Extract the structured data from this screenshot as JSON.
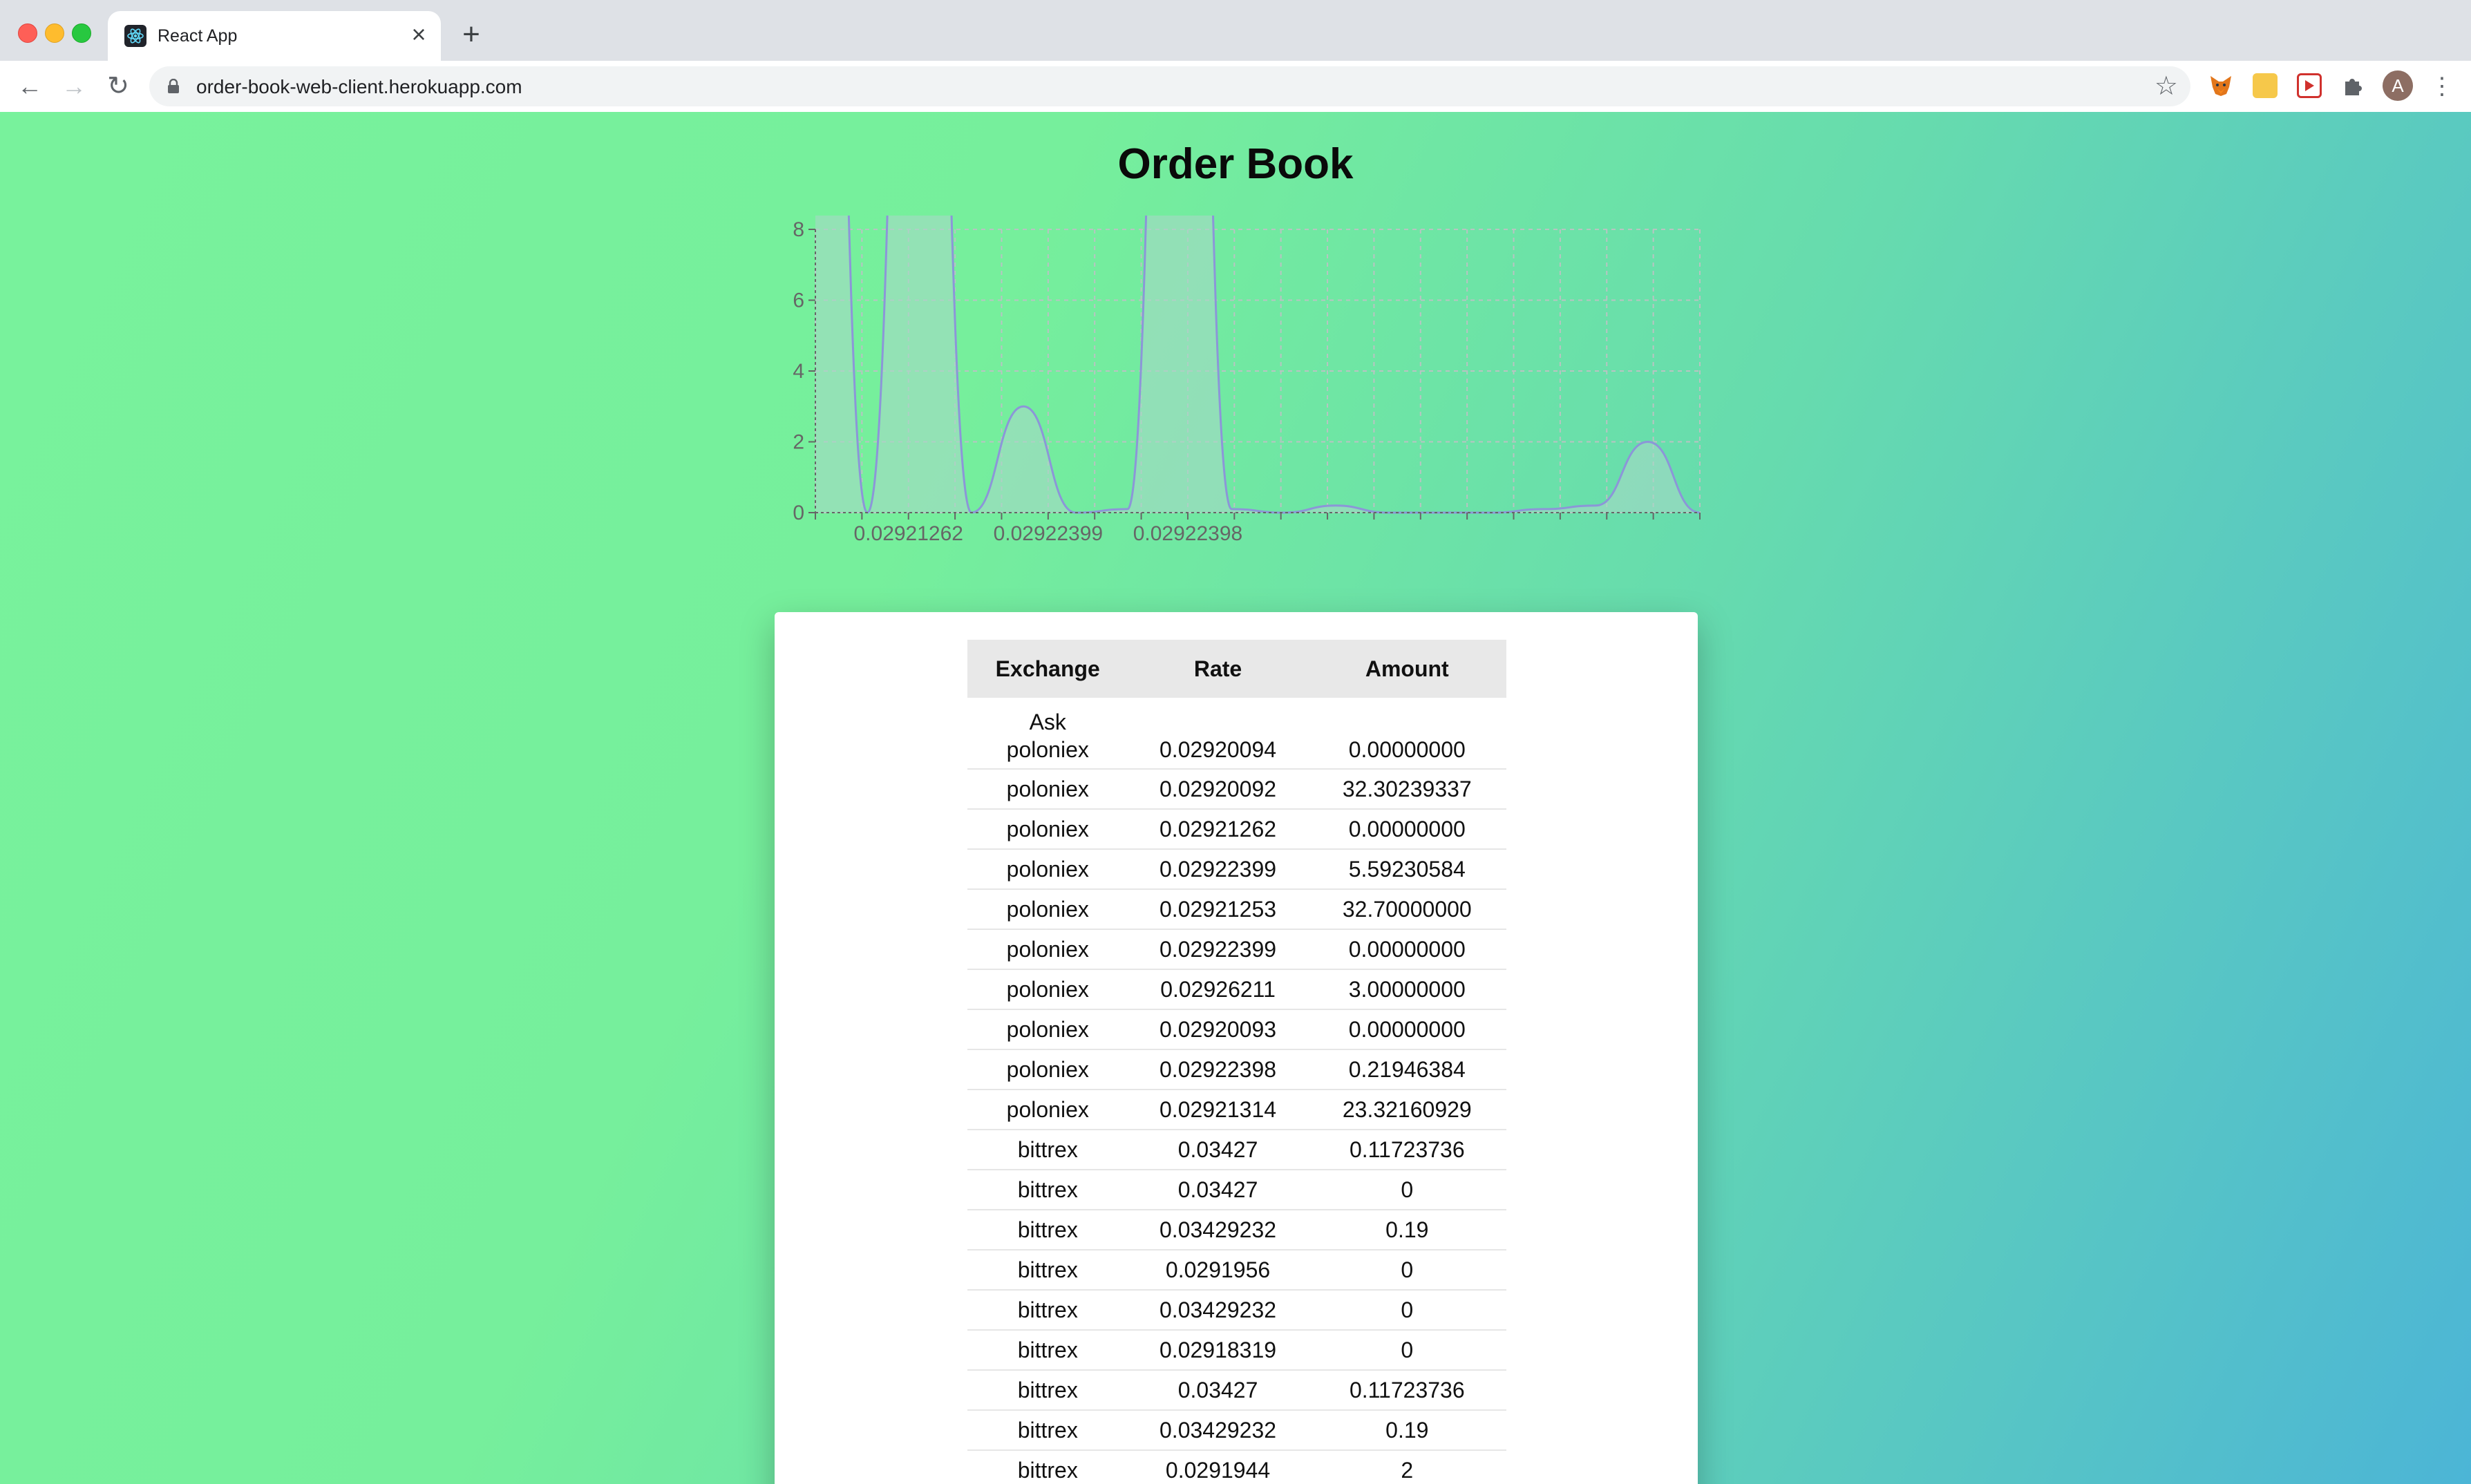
{
  "browser": {
    "tab_title": "React App",
    "new_tab_label": "+",
    "close_label": "×",
    "url": "order-book-web-client.herokuapp.com",
    "avatar_letter": "A"
  },
  "page": {
    "title": "Order Book"
  },
  "chart_data": {
    "type": "area",
    "y_ticks": [
      "0",
      "2",
      "4",
      "6",
      "8"
    ],
    "x_tick_labels": [
      "0.02921262",
      "0.02922399",
      "0.02922398"
    ],
    "ylim": [
      0,
      8
    ],
    "grid": true,
    "series_values": [
      35,
      0,
      30,
      0,
      3,
      0,
      0.1,
      35,
      0.1,
      0,
      0.2,
      0,
      0,
      0,
      0.1,
      0.2,
      2,
      0
    ],
    "colors": {
      "line": "#8c96d8",
      "fill": "#a6d8c6",
      "grid": "#b8c4c2",
      "axis": "#666666"
    }
  },
  "table": {
    "headers": [
      "Exchange",
      "Rate",
      "Amount"
    ],
    "section_label": "Ask",
    "rows": [
      [
        "poloniex",
        "0.02920094",
        "0.00000000"
      ],
      [
        "poloniex",
        "0.02920092",
        "32.30239337"
      ],
      [
        "poloniex",
        "0.02921262",
        "0.00000000"
      ],
      [
        "poloniex",
        "0.02922399",
        "5.59230584"
      ],
      [
        "poloniex",
        "0.02921253",
        "32.70000000"
      ],
      [
        "poloniex",
        "0.02922399",
        "0.00000000"
      ],
      [
        "poloniex",
        "0.02926211",
        "3.00000000"
      ],
      [
        "poloniex",
        "0.02920093",
        "0.00000000"
      ],
      [
        "poloniex",
        "0.02922398",
        "0.21946384"
      ],
      [
        "poloniex",
        "0.02921314",
        "23.32160929"
      ],
      [
        "bittrex",
        "0.03427",
        "0.11723736"
      ],
      [
        "bittrex",
        "0.03427",
        "0"
      ],
      [
        "bittrex",
        "0.03429232",
        "0.19"
      ],
      [
        "bittrex",
        "0.0291956",
        "0"
      ],
      [
        "bittrex",
        "0.03429232",
        "0"
      ],
      [
        "bittrex",
        "0.02918319",
        "0"
      ],
      [
        "bittrex",
        "0.03427",
        "0.11723736"
      ],
      [
        "bittrex",
        "0.03429232",
        "0.19"
      ],
      [
        "bittrex",
        "0.0291944",
        "2"
      ]
    ]
  }
}
